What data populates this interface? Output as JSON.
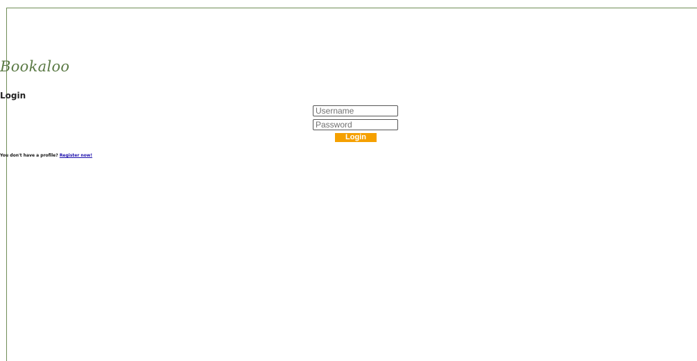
{
  "app": {
    "brand": "Bookaloo"
  },
  "login_form": {
    "heading": "Login",
    "username_placeholder": "Username",
    "password_placeholder": "Password",
    "submit_label": "Login"
  },
  "register": {
    "prompt": "You don't have a profile?",
    "link_text": "Register now!"
  },
  "colors": {
    "brand": "#5b7a45",
    "button": "#f5a000",
    "link": "#1a0dab"
  }
}
